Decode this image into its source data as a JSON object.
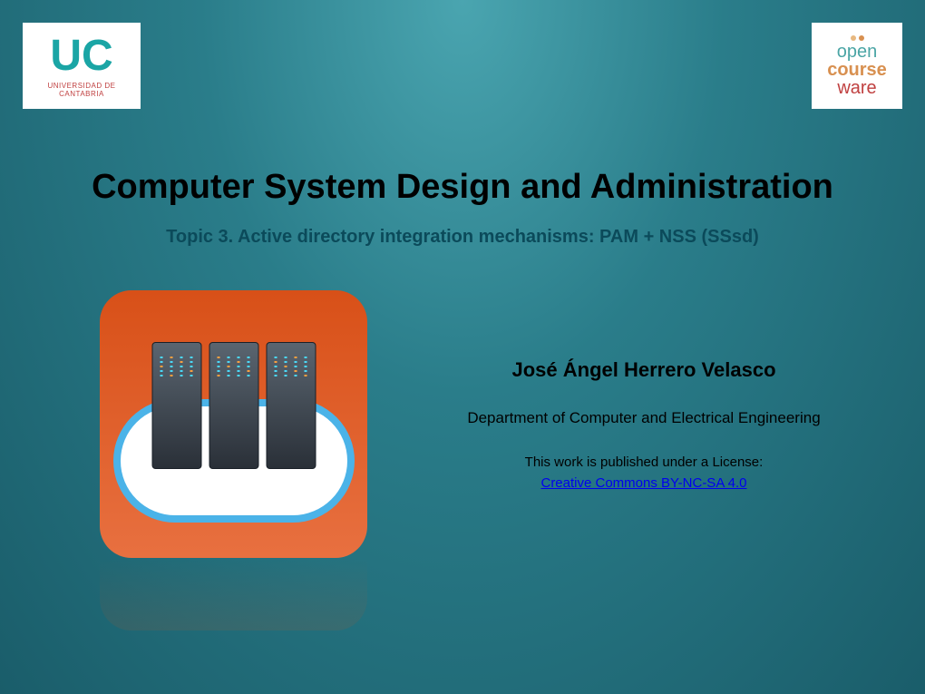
{
  "logos": {
    "uc": {
      "main": "UC",
      "sub": "UNIVERSIDAD DE CANTABRIA"
    },
    "ocw": {
      "line1": "open",
      "line2": "course",
      "line3": "ware"
    }
  },
  "title": "Computer System Design and Administration",
  "subtitle": "Topic 3. Active directory integration mechanisms: PAM + NSS (SSsd)",
  "author": "José Ángel Herrero Velasco",
  "department": "Department of Computer and Electrical Engineering",
  "license_intro": "This work is published under a License:",
  "license_link": "Creative Commons BY-NC-SA 4.0"
}
